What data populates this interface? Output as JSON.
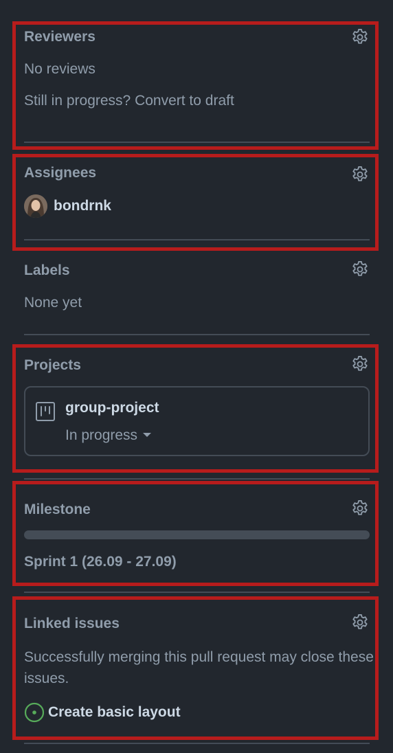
{
  "reviewers": {
    "title": "Reviewers",
    "empty_text": "No reviews",
    "draft_prompt": "Still in progress? Convert to draft"
  },
  "assignees": {
    "title": "Assignees",
    "items": [
      {
        "username": "bondrnk"
      }
    ]
  },
  "labels": {
    "title": "Labels",
    "empty_text": "None yet"
  },
  "projects": {
    "title": "Projects",
    "items": [
      {
        "name": "group-project",
        "status": "In progress"
      }
    ]
  },
  "milestone": {
    "title": "Milestone",
    "name": "Sprint 1 (26.09 - 27.09)",
    "progress_fraction": 0
  },
  "linked_issues": {
    "title": "Linked issues",
    "description": "Successfully merging this pull request may close these issues.",
    "items": [
      {
        "title": "Create basic layout",
        "state": "open"
      }
    ]
  },
  "icons": {
    "settings": "gear-icon",
    "project": "project-board-icon",
    "issue_open": "issue-opened-icon",
    "dropdown": "triangle-down-icon"
  },
  "colors": {
    "background": "#22272e",
    "heading": "#909dab",
    "text_strong": "#cdd9e5",
    "divider": "#444c56",
    "highlight_border": "#b71c1c",
    "issue_open": "#57ab5a"
  }
}
